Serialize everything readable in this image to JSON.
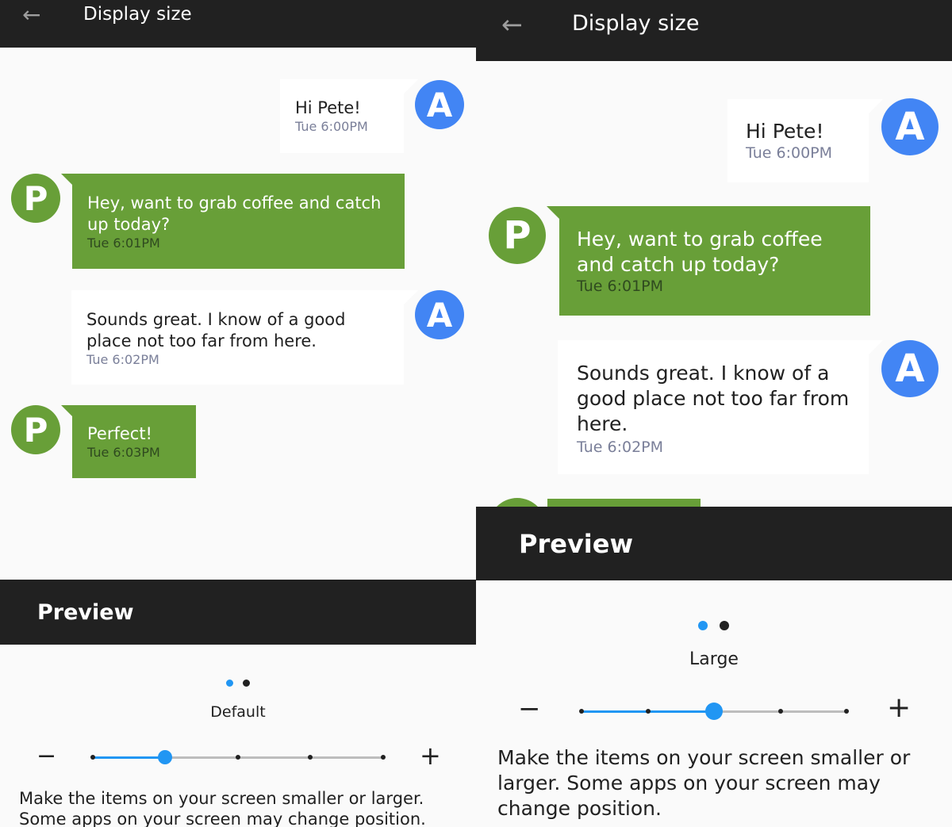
{
  "left": {
    "header": {
      "title": "Display size",
      "back_icon": "arrow-left-icon"
    },
    "messages": [
      {
        "sender": "A",
        "text": "Hi Pete!",
        "time": "Tue 6:00PM"
      },
      {
        "sender": "P",
        "text": "Hey, want to grab coffee and catch up today?",
        "time": "Tue 6:01PM"
      },
      {
        "sender": "A",
        "text": "Sounds great. I know of a good place not too far from here.",
        "time": "Tue 6:02PM"
      },
      {
        "sender": "P",
        "text": "Perfect!",
        "time": "Tue 6:03PM"
      }
    ],
    "preview_label": "Preview",
    "page_indicator": {
      "count": 2,
      "active": 1
    },
    "size_label": "Default",
    "slider": {
      "steps": 5,
      "value_index": 2,
      "minus": "−",
      "plus": "+"
    },
    "description": "Make the items on your screen smaller or larger. Some apps on your screen may change position."
  },
  "right": {
    "header": {
      "title": "Display size",
      "back_icon": "arrow-left-icon"
    },
    "messages": [
      {
        "sender": "A",
        "text": "Hi Pete!",
        "time": "Tue 6:00PM"
      },
      {
        "sender": "P",
        "text": "Hey, want to grab coffee and catch up today?",
        "time": "Tue 6:01PM"
      },
      {
        "sender": "A",
        "text": "Sounds great. I know of a good place not too far from here.",
        "time": "Tue 6:02PM"
      }
    ],
    "preview_label": "Preview",
    "page_indicator": {
      "count": 2,
      "active": 1
    },
    "size_label": "Large",
    "slider": {
      "steps": 5,
      "value_index": 3,
      "minus": "−",
      "plus": "+"
    },
    "description": "Make the items on your screen smaller or larger. Some apps on your screen may change position."
  },
  "colors": {
    "header": "#212121",
    "avatar_a": "#4285f4",
    "avatar_p": "#689f38",
    "accent": "#2196f3",
    "background": "#fafafa"
  }
}
